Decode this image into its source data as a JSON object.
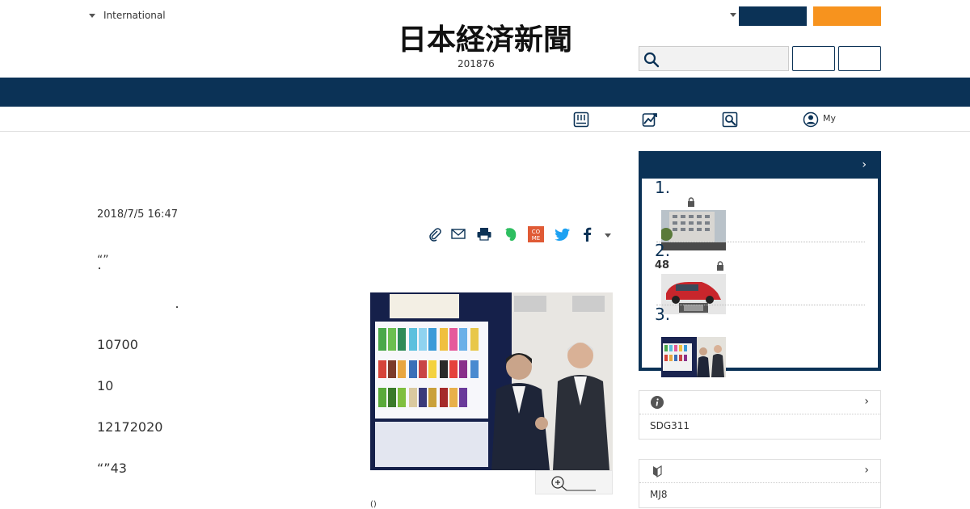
{
  "header": {
    "edition_label": "International",
    "logo_text": "日本経済新聞",
    "date_text": "201876",
    "search_placeholder": "",
    "my_label": "My"
  },
  "colors": {
    "navy": "#0b3256",
    "orange": "#f7931e"
  },
  "icons": {
    "sub_nav": [
      "newspaper-icon",
      "chart-icon",
      "search-page-icon",
      "user-icon"
    ],
    "share": [
      "clip-icon",
      "mail-icon",
      "print-icon",
      "evernote-icon",
      "come-icon",
      "twitter-icon",
      "facebook-icon"
    ]
  },
  "article": {
    "pubdate": "2018/7/5 16:47",
    "paragraphs": [
      "“”",
      "10700",
      "10",
      "12172020",
      "“”43"
    ],
    "dot": "・",
    "caption": "()"
  },
  "ranking": {
    "items": [
      {
        "number": "1."
      },
      {
        "number": "2.",
        "extra": "48"
      },
      {
        "number": "3."
      }
    ]
  },
  "boxes": [
    {
      "body": "SDG311"
    },
    {
      "body": "MJ8"
    }
  ]
}
